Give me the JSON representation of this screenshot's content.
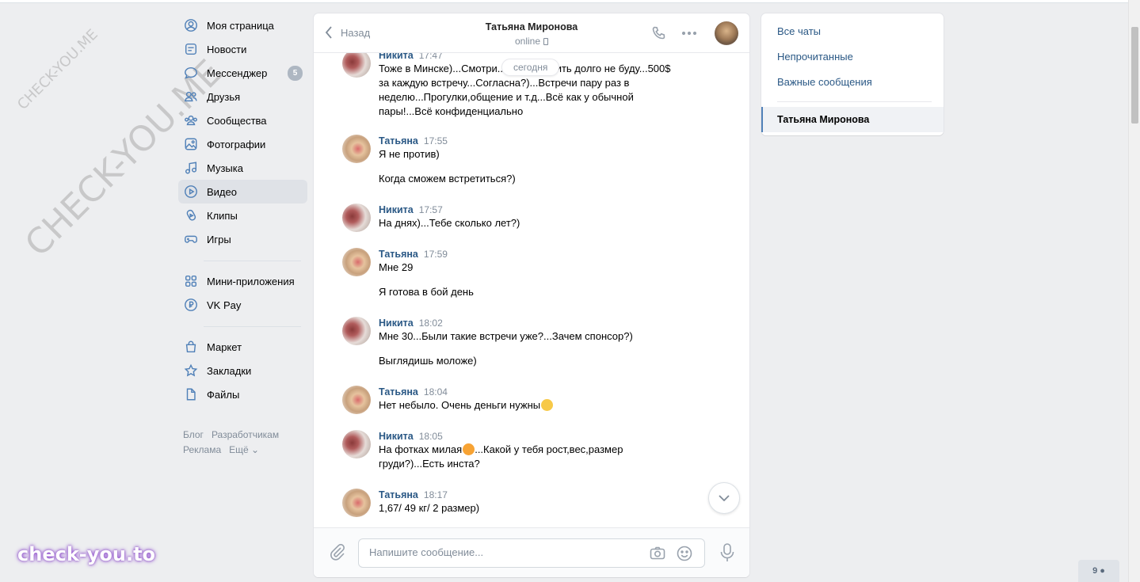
{
  "watermark": {
    "small": "CHECK-YOU.ME",
    "large": "CHECK-YOU.ME",
    "brand": "check-you.to"
  },
  "nav": {
    "items": [
      {
        "label": "Моя страница",
        "icon": "user-circle-icon"
      },
      {
        "label": "Новости",
        "icon": "news-icon"
      },
      {
        "label": "Мессенджер",
        "icon": "message-icon",
        "badge": "5"
      },
      {
        "label": "Друзья",
        "icon": "friends-icon"
      },
      {
        "label": "Сообщества",
        "icon": "groups-icon"
      },
      {
        "label": "Фотографии",
        "icon": "photo-icon"
      },
      {
        "label": "Музыка",
        "icon": "music-icon"
      },
      {
        "label": "Видео",
        "icon": "video-icon",
        "active": true
      },
      {
        "label": "Клипы",
        "icon": "clips-icon"
      },
      {
        "label": "Игры",
        "icon": "gamepad-icon"
      }
    ],
    "items2": [
      {
        "label": "Мини-приложения",
        "icon": "apps-icon"
      },
      {
        "label": "VK Pay",
        "icon": "vkpay-icon"
      }
    ],
    "items3": [
      {
        "label": "Маркет",
        "icon": "bag-icon"
      },
      {
        "label": "Закладки",
        "icon": "star-icon"
      },
      {
        "label": "Файлы",
        "icon": "file-icon"
      }
    ],
    "footer": {
      "blog": "Блог",
      "dev": "Разработчикам",
      "ads": "Реклама",
      "more": "Ещё ⌄"
    }
  },
  "chat": {
    "back_label": "Назад",
    "peer_name": "Татьяна Миронова",
    "peer_status": "online",
    "date_pill": "сегодня",
    "messages": [
      {
        "author": "Никита",
        "time": "17:47",
        "text": "Тоже в Минске)...Смотри... около ходить долго не буду...500$ за каждую встречу...Согласна?)...Встречи пару раз в неделю...Прогулки,общение и т.д...Всё как у обычной пары!...Всё конфиденциально"
      },
      {
        "author": "Татьяна",
        "time": "17:55",
        "text": "Я не против)",
        "text2": "Когда сможем встретиться?)"
      },
      {
        "author": "Никита",
        "time": "17:57",
        "text": "На днях)...Тебе сколько лет?)"
      },
      {
        "author": "Татьяна",
        "time": "17:59",
        "text": "Мне 29",
        "text2": "Я готова в бой день"
      },
      {
        "author": "Никита",
        "time": "18:02",
        "text": "Мне 30...Были такие встречи уже?...Зачем спонсор?)",
        "text2": "Выглядишь моложе)"
      },
      {
        "author": "Татьяна",
        "time": "18:04",
        "text": "Нет небыло. Очень деньги нужны"
      },
      {
        "author": "Никита",
        "time": "18:05",
        "text_a": "На фотках милая",
        "text_b": "...Какой у тебя рост,вес,размер груди?)...Есть инста?"
      },
      {
        "author": "Татьяна",
        "time": "18:17",
        "text": "1,67/ 49 кг/ 2 размер)"
      }
    ],
    "composer_placeholder": "Напишите сообщение..."
  },
  "folders": {
    "all": "Все чаты",
    "unread": "Непрочитанные",
    "important": "Важные сообщения",
    "current": "Татьяна Миронова"
  },
  "online_count": "9"
}
